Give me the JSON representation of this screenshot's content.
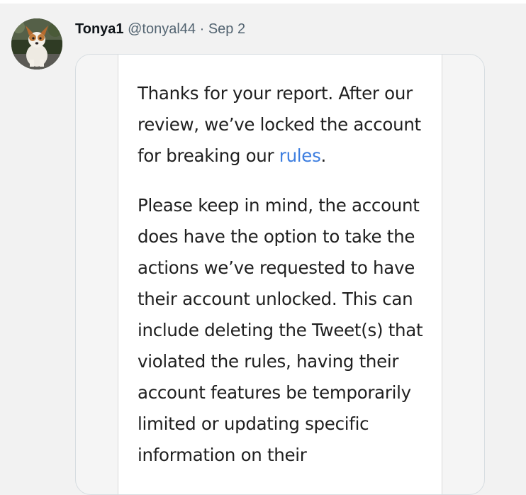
{
  "tweet": {
    "author_name": "Tonya1",
    "author_handle": "@tonyal44",
    "separator": "·",
    "date": "Sep 2"
  },
  "screenshot": {
    "paragraph1": {
      "before_link": "Thanks for your report. After our review, we’ve locked the account for breaking our ",
      "link_text": "rules",
      "after_link": "."
    },
    "paragraph2": "Please keep in mind, the account does have the option to take the actions we’ve requested to have their account unlocked. This can include deleting the Tweet(s) that violated the rules, having their account features be temporarily limited or updating specific information on their"
  },
  "colors": {
    "link": "#3d7ee0",
    "handle": "#536471",
    "name": "#0f1419"
  }
}
